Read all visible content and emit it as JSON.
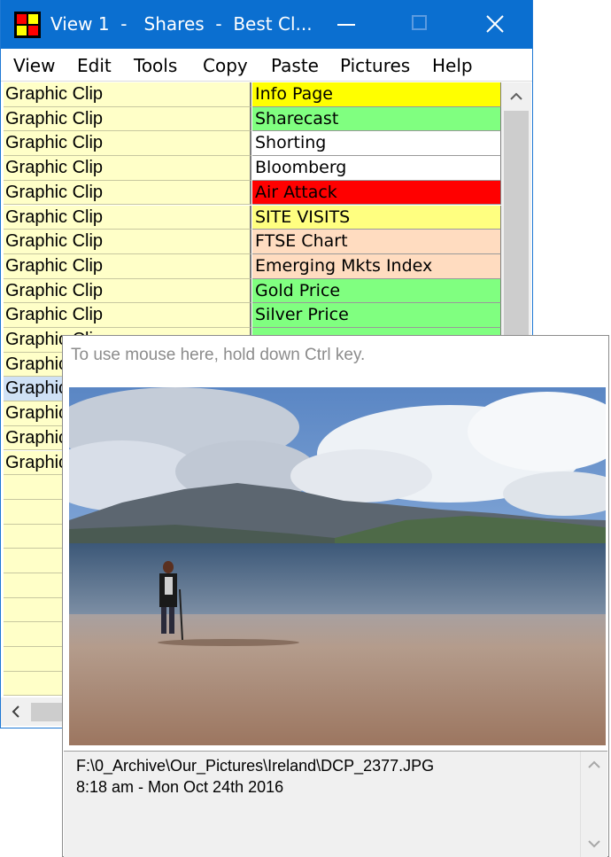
{
  "window": {
    "title": "View 1  -   Shares  -  Best Cl...",
    "menu": [
      "View",
      "Edit",
      "Tools",
      "Copy",
      "Paste",
      "Pictures",
      "Help"
    ]
  },
  "rows": [
    {
      "left": "Graphic Clip",
      "right": "Info Page",
      "color": "#ffff00"
    },
    {
      "left": "Graphic Clip",
      "right": "Sharecast",
      "color": "#80ff80"
    },
    {
      "left": "Graphic Clip",
      "right": "Shorting",
      "color": "#ffffff"
    },
    {
      "left": "Graphic Clip",
      "right": "Bloomberg",
      "color": "#ffffff"
    },
    {
      "left": "Graphic Clip",
      "right": "Air Attack",
      "color": "#ff0000"
    },
    {
      "left": "Graphic Clip",
      "right": "SITE VISITS",
      "color": "#ffff80"
    },
    {
      "left": "Graphic Clip",
      "right": "FTSE Chart",
      "color": "#ffdcc0"
    },
    {
      "left": "Graphic Clip",
      "right": "Emerging Mkts Index",
      "color": "#ffdcc0"
    },
    {
      "left": "Graphic Clip",
      "right": "Gold Price",
      "color": "#80ff80"
    },
    {
      "left": "Graphic Clip",
      "right": "Silver Price",
      "color": "#80ff80"
    },
    {
      "left": "Graphic Clip",
      "right": "",
      "color": "#80ff80"
    },
    {
      "left": "Graphic Clip",
      "right": "",
      "color": "#ffffff"
    },
    {
      "left": "Graphic Clip",
      "right": "",
      "color": "#ffffff",
      "selected": true
    },
    {
      "left": "Graphic Clip",
      "right": "",
      "color": "#ffffff"
    },
    {
      "left": "Graphic Clip",
      "right": "",
      "color": "#ffffff"
    },
    {
      "left": "Graphic Clip",
      "right": "",
      "color": "#ffffff"
    },
    {
      "left": "",
      "right": "",
      "color": "#ffffff"
    },
    {
      "left": "",
      "right": "",
      "color": "#ffffff"
    },
    {
      "left": "",
      "right": "",
      "color": "#ffffff"
    },
    {
      "left": "",
      "right": "",
      "color": "#ffffff"
    },
    {
      "left": "",
      "right": "",
      "color": "#ffffff"
    },
    {
      "left": "",
      "right": "",
      "color": "#ffffff"
    },
    {
      "left": "",
      "right": "",
      "color": "#ffffff"
    },
    {
      "left": "",
      "right": "",
      "color": "#ffffff"
    },
    {
      "left": "",
      "right": "",
      "color": "#ffffff"
    }
  ],
  "popup": {
    "hint": "To use mouse here, hold down Ctrl key.",
    "path": "F:\\0_Archive\\Our_Pictures\\Ireland\\DCP_2377.JPG",
    "datetime": "8:18 am - Mon Oct 24th  2016"
  }
}
